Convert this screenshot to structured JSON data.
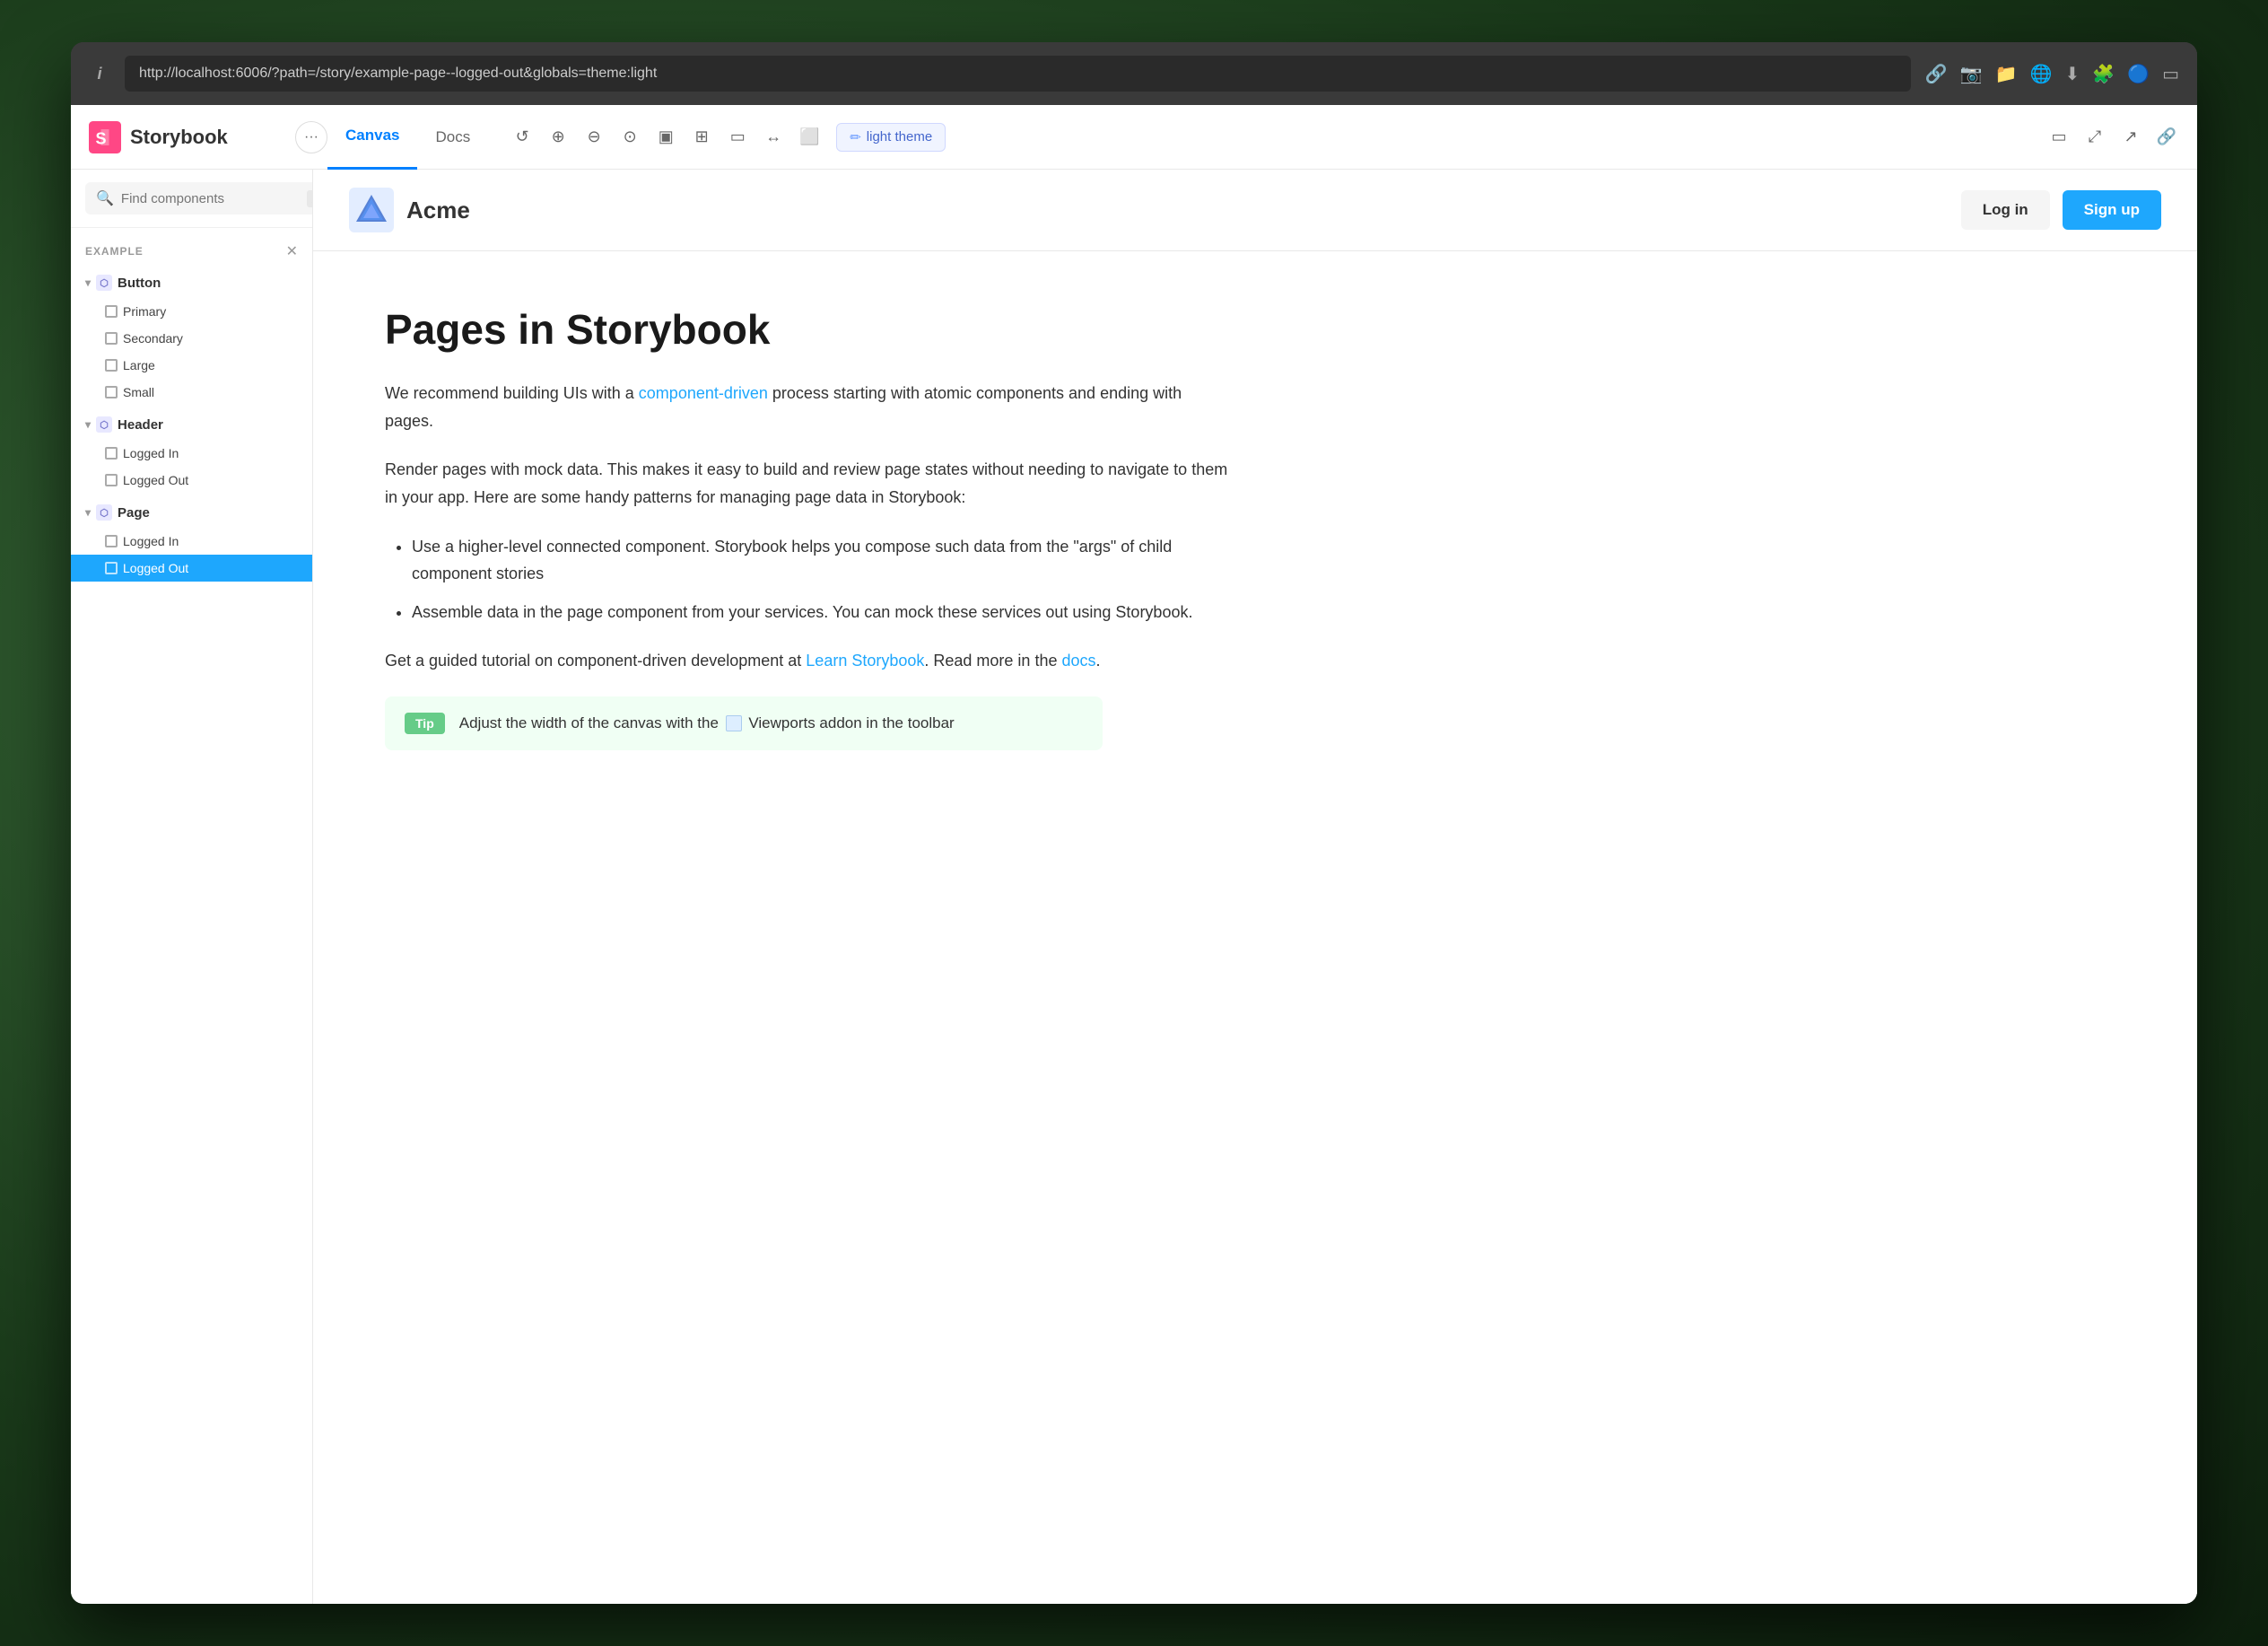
{
  "browser": {
    "url": "http://localhost:6006/?path=/story/example-page--logged-out&globals=theme:light",
    "info_icon": "i"
  },
  "storybook": {
    "title": "Storybook",
    "menu_btn_label": "•••"
  },
  "toolbar": {
    "tab_canvas": "Canvas",
    "tab_docs": "Docs",
    "theme_btn": "light theme",
    "theme_icon": "✏"
  },
  "sidebar": {
    "search_placeholder": "Find components",
    "search_shortcut": "/",
    "section_label": "EXAMPLE",
    "groups": [
      {
        "id": "button",
        "label": "Button",
        "items": [
          "Primary",
          "Secondary",
          "Large",
          "Small"
        ]
      },
      {
        "id": "header",
        "label": "Header",
        "items": [
          "Logged In",
          "Logged Out"
        ]
      },
      {
        "id": "page",
        "label": "Page",
        "items": [
          "Logged In",
          "Logged Out"
        ]
      }
    ],
    "active_item": "Logged Out",
    "active_group": "page"
  },
  "page_preview": {
    "logo_text": "Acme",
    "login_btn": "Log in",
    "signup_btn": "Sign up",
    "title": "Pages in Storybook",
    "paragraph1_before": "We recommend building UIs with a ",
    "paragraph1_link": "component-driven",
    "paragraph1_after": " process starting with atomic components and ending with pages.",
    "paragraph2": "Render pages with mock data. This makes it easy to build and review page states without needing to navigate to them in your app. Here are some handy patterns for managing page data in Storybook:",
    "list_items": [
      "Use a higher-level connected component. Storybook helps you compose such data from the \"args\" of child component stories",
      "Assemble data in the page component from your services. You can mock these services out using Storybook."
    ],
    "paragraph3_before": "Get a guided tutorial on component-driven development at ",
    "paragraph3_link": "Learn Storybook",
    "paragraph3_after": ". Read more in the ",
    "paragraph3_link2": "docs",
    "paragraph3_end": ".",
    "tip_label": "Tip",
    "tip_text_before": "Adjust the width of the canvas with the ",
    "tip_text_after": " Viewports addon in the toolbar"
  }
}
